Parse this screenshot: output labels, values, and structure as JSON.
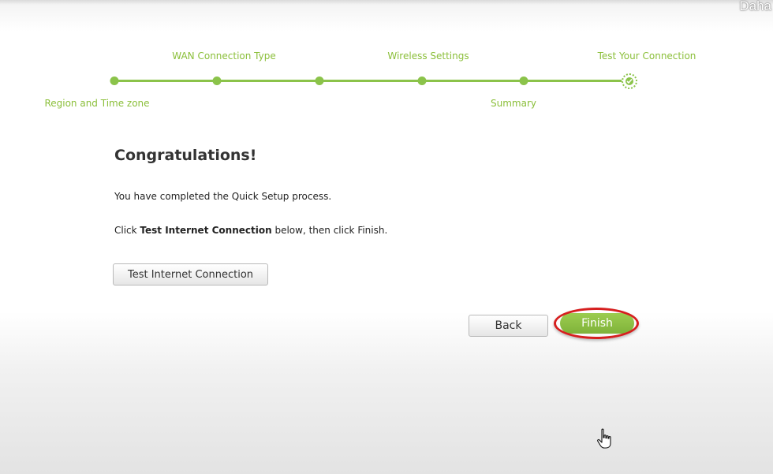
{
  "corner_text": "Daha",
  "steps": {
    "region": "Region and Time zone",
    "wan": "WAN Connection Type",
    "wireless": "Wireless Settings",
    "summary": "Summary",
    "test": "Test Your Connection"
  },
  "content": {
    "heading": "Congratulations!",
    "line1": "You have completed the Quick Setup process.",
    "line2_prefix": "Click ",
    "line2_bold": "Test Internet Connection",
    "line2_suffix": " below, then click Finish.",
    "test_button": "Test Internet Connection"
  },
  "buttons": {
    "back": "Back",
    "finish": "Finish"
  },
  "colors": {
    "accent": "#8bc34a",
    "highlight_ring": "#d61f1f"
  },
  "icons": {
    "complete": "check-circle-icon",
    "cursor": "hand-pointer-icon"
  }
}
